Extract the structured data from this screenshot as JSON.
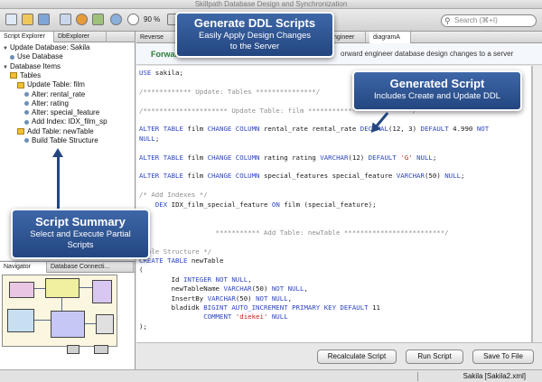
{
  "window": {
    "title": "Skillpath Database Design and Synchronization"
  },
  "toolbar": {
    "zoom": "90 %",
    "search_placeholder": "Search (⌘+I)"
  },
  "left_panel": {
    "tabs": [
      "Script Explorer",
      "DbExplorer"
    ],
    "tree": [
      {
        "label": "Update Database: Sakila",
        "level": 0,
        "kind": "arrow"
      },
      {
        "label": "Use Database",
        "level": 1,
        "kind": "bullet"
      },
      {
        "label": "Database Items",
        "level": 0,
        "kind": "arrow"
      },
      {
        "label": "Tables",
        "level": 1,
        "kind": "pkg"
      },
      {
        "label": "Update Table: film",
        "level": 2,
        "kind": "pkg"
      },
      {
        "label": "Alter: rental_rate",
        "level": 3,
        "kind": "bullet"
      },
      {
        "label": "Alter: rating",
        "level": 3,
        "kind": "bullet"
      },
      {
        "label": "Alter: special_feature",
        "level": 3,
        "kind": "bullet"
      },
      {
        "label": "Add Index: IDX_film_sp",
        "level": 3,
        "kind": "bullet"
      },
      {
        "label": "Add Table: newTable",
        "level": 2,
        "kind": "pkg"
      },
      {
        "label": "Build Table Structure",
        "level": 3,
        "kind": "bullet"
      }
    ]
  },
  "navigator": {
    "tabs": [
      "Navigator",
      "Database Connecti..."
    ]
  },
  "editor": {
    "tabs": [
      "Reverse",
      "ngineer",
      "diagramA"
    ],
    "forward_title": "Forward",
    "forward_desc": "orward engineer database design changes to a server"
  },
  "code_lines": [
    [
      {
        "t": "USE",
        "c": "kw"
      },
      {
        "t": " sakila;",
        "c": ""
      }
    ],
    [],
    [
      {
        "t": "/************ Update: Tables ***************/",
        "c": "cm"
      }
    ],
    [],
    [
      {
        "t": "/********************* Update Table: film **************************/",
        "c": "cm"
      }
    ],
    [],
    [
      {
        "t": "ALTER TABLE",
        "c": "kw"
      },
      {
        "t": " film ",
        "c": ""
      },
      {
        "t": "CHANGE COLUMN",
        "c": "kw"
      },
      {
        "t": " rental_rate rental_rate ",
        "c": ""
      },
      {
        "t": "DECIMAL",
        "c": "kw"
      },
      {
        "t": "(12, 3) ",
        "c": ""
      },
      {
        "t": "DEFAULT",
        "c": "kw"
      },
      {
        "t": " 4.990 ",
        "c": ""
      },
      {
        "t": "NOT",
        "c": "kw"
      }
    ],
    [
      {
        "t": "NULL",
        "c": "kw"
      },
      {
        "t": ";",
        "c": ""
      }
    ],
    [],
    [
      {
        "t": "ALTER TABLE",
        "c": "kw"
      },
      {
        "t": " film ",
        "c": ""
      },
      {
        "t": "CHANGE COLUMN",
        "c": "kw"
      },
      {
        "t": " rating rating ",
        "c": ""
      },
      {
        "t": "VARCHAR",
        "c": "kw"
      },
      {
        "t": "(12) ",
        "c": ""
      },
      {
        "t": "DEFAULT",
        "c": "kw"
      },
      {
        "t": " 'G' ",
        "c": "str"
      },
      {
        "t": "NULL",
        "c": "kw"
      },
      {
        "t": ";",
        "c": ""
      }
    ],
    [],
    [
      {
        "t": "ALTER TABLE",
        "c": "kw"
      },
      {
        "t": " film ",
        "c": ""
      },
      {
        "t": "CHANGE COLUMN",
        "c": "kw"
      },
      {
        "t": " special_features special_feature ",
        "c": ""
      },
      {
        "t": "VARCHAR",
        "c": "kw"
      },
      {
        "t": "(50) ",
        "c": ""
      },
      {
        "t": "NULL",
        "c": "kw"
      },
      {
        "t": ";",
        "c": ""
      }
    ],
    [],
    [
      {
        "t": "/* Add Indexes */",
        "c": "cm"
      }
    ],
    [
      {
        "t": "    ",
        "c": ""
      },
      {
        "t": "DEX",
        "c": "kw"
      },
      {
        "t": " IDX_film_special_feature ",
        "c": ""
      },
      {
        "t": "ON",
        "c": "kw"
      },
      {
        "t": " film (special_feature);",
        "c": ""
      }
    ],
    [],
    [],
    [
      {
        "t": "                   *********** Add Table: newTable *************************/",
        "c": "cm"
      }
    ],
    [],
    [
      {
        "t": "  ble Structure */",
        "c": "cm"
      }
    ],
    [
      {
        "t": "CREATE TABLE",
        "c": "kw"
      },
      {
        "t": " newTable",
        "c": ""
      }
    ],
    [
      {
        "t": "(",
        "c": ""
      }
    ],
    [
      {
        "t": "        Id ",
        "c": ""
      },
      {
        "t": "INTEGER NOT NULL",
        "c": "kw"
      },
      {
        "t": ",",
        "c": ""
      }
    ],
    [
      {
        "t": "        newTableName ",
        "c": ""
      },
      {
        "t": "VARCHAR",
        "c": "kw"
      },
      {
        "t": "(50) ",
        "c": ""
      },
      {
        "t": "NOT NULL",
        "c": "kw"
      },
      {
        "t": ",",
        "c": ""
      }
    ],
    [
      {
        "t": "        InsertBy ",
        "c": ""
      },
      {
        "t": "VARCHAR",
        "c": "kw"
      },
      {
        "t": "(50) ",
        "c": ""
      },
      {
        "t": "NOT NULL",
        "c": "kw"
      },
      {
        "t": ",",
        "c": ""
      }
    ],
    [
      {
        "t": "        bladidk ",
        "c": ""
      },
      {
        "t": "BIGINT AUTO_INCREMENT PRIMARY KEY DEFAULT",
        "c": "kw"
      },
      {
        "t": " 11",
        "c": ""
      }
    ],
    [
      {
        "t": "                ",
        "c": ""
      },
      {
        "t": "COMMENT",
        "c": "kw"
      },
      {
        "t": " 'diekei' ",
        "c": "str"
      },
      {
        "t": "NULL",
        "c": "kw"
      }
    ],
    [
      {
        "t": ");",
        "c": ""
      }
    ]
  ],
  "buttons": {
    "recalculate": "Recalculate Script",
    "run": "Run Script",
    "save": "Save To File"
  },
  "status": {
    "connection": "Sakila [Sakila2.xml]"
  },
  "callouts": {
    "ddl": {
      "title": "Generate DDL Scripts",
      "lines": [
        "Easily Apply Design Changes",
        "to the Server"
      ]
    },
    "generated": {
      "title": "Generated Script",
      "lines": [
        "Includes Create and Update DDL"
      ]
    },
    "summary": {
      "title": "Script Summary",
      "lines": [
        "Select and Execute Partial",
        "Scripts"
      ]
    }
  },
  "colors": {
    "callout": "#2f5596",
    "keyword": "#3048c0",
    "comment": "#8e8e8e",
    "string": "#c02820",
    "forward": "#2c7f3a"
  }
}
